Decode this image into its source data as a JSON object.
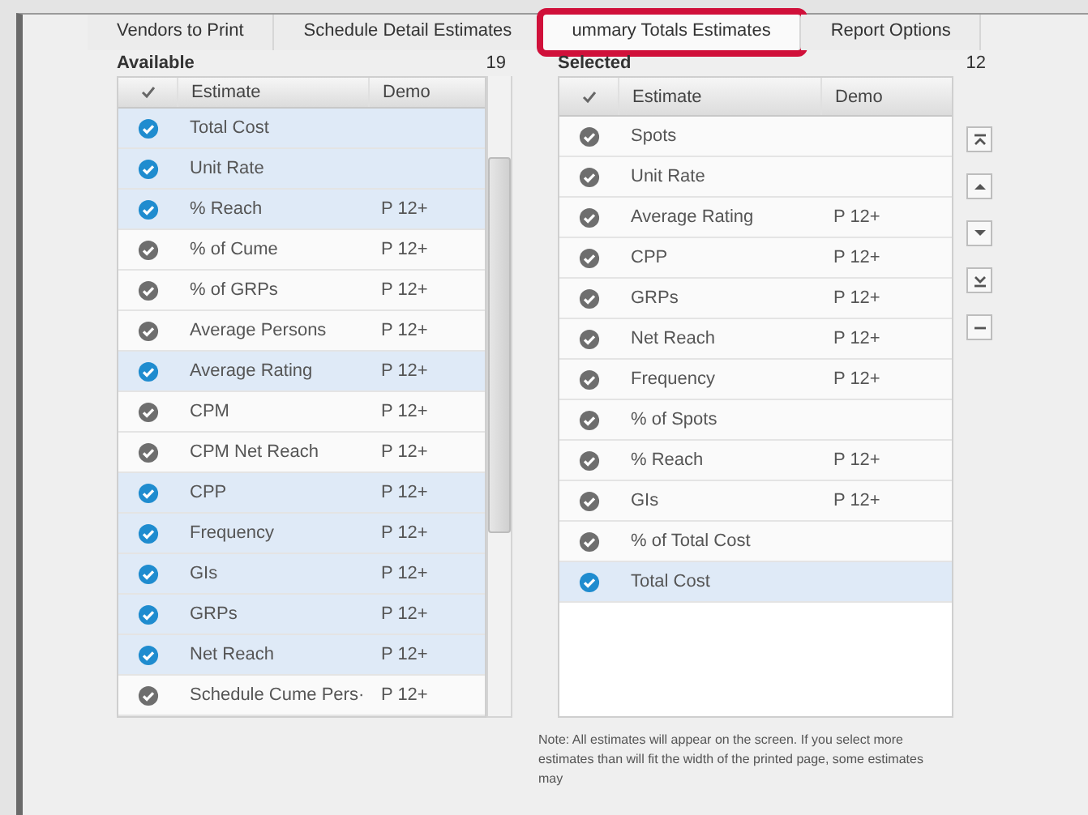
{
  "tabs": [
    {
      "label": "Vendors to Print",
      "selected": false,
      "highlighted": false
    },
    {
      "label": "Schedule Detail Estimates",
      "selected": false,
      "highlighted": false
    },
    {
      "label": "ummary Totals Estimates",
      "selected": true,
      "highlighted": true
    },
    {
      "label": "Report Options",
      "selected": false,
      "highlighted": false
    }
  ],
  "available": {
    "title": "Available",
    "count": "19",
    "columns": [
      "Estimate",
      "Demo"
    ],
    "rows": [
      {
        "estimate": "Total Cost",
        "demo": "",
        "checked": true
      },
      {
        "estimate": "Unit Rate",
        "demo": "",
        "checked": true
      },
      {
        "estimate": "% Reach",
        "demo": "P 12+",
        "checked": true
      },
      {
        "estimate": "% of Cume",
        "demo": "P 12+",
        "checked": false
      },
      {
        "estimate": "% of GRPs",
        "demo": "P 12+",
        "checked": false
      },
      {
        "estimate": "Average Persons",
        "demo": "P 12+",
        "checked": false
      },
      {
        "estimate": "Average Rating",
        "demo": "P 12+",
        "checked": true
      },
      {
        "estimate": "CPM",
        "demo": "P 12+",
        "checked": false
      },
      {
        "estimate": "CPM Net Reach",
        "demo": "P 12+",
        "checked": false
      },
      {
        "estimate": "CPP",
        "demo": "P 12+",
        "checked": true
      },
      {
        "estimate": "Frequency",
        "demo": "P 12+",
        "checked": true
      },
      {
        "estimate": "GIs",
        "demo": "P 12+",
        "checked": true
      },
      {
        "estimate": "GRPs",
        "demo": "P 12+",
        "checked": true
      },
      {
        "estimate": "Net Reach",
        "demo": "P 12+",
        "checked": true
      },
      {
        "estimate": "Schedule Cume Pers·",
        "demo": "P 12+",
        "checked": false
      }
    ]
  },
  "selected": {
    "title": "Selected",
    "count": "12",
    "columns": [
      "Estimate",
      "Demo"
    ],
    "rows": [
      {
        "estimate": "Spots",
        "demo": "",
        "checked": false
      },
      {
        "estimate": "Unit Rate",
        "demo": "",
        "checked": false
      },
      {
        "estimate": "Average Rating",
        "demo": "P 12+",
        "checked": false
      },
      {
        "estimate": "CPP",
        "demo": "P 12+",
        "checked": false
      },
      {
        "estimate": "GRPs",
        "demo": "P 12+",
        "checked": false
      },
      {
        "estimate": "Net Reach",
        "demo": "P 12+",
        "checked": false
      },
      {
        "estimate": "Frequency",
        "demo": "P 12+",
        "checked": false
      },
      {
        "estimate": "% of Spots",
        "demo": "",
        "checked": false
      },
      {
        "estimate": "% Reach",
        "demo": "P 12+",
        "checked": false
      },
      {
        "estimate": "GIs",
        "demo": "P 12+",
        "checked": false
      },
      {
        "estimate": "% of Total Cost",
        "demo": "",
        "checked": false
      },
      {
        "estimate": "Total Cost",
        "demo": "",
        "checked": true
      }
    ]
  },
  "order_buttons": [
    {
      "kind": "top"
    },
    {
      "kind": "up"
    },
    {
      "kind": "down"
    },
    {
      "kind": "bottom"
    },
    {
      "kind": "remove"
    }
  ],
  "note": "Note: All estimates will appear on the screen. If you select more estimates than will fit the width of the printed page, some estimates may"
}
